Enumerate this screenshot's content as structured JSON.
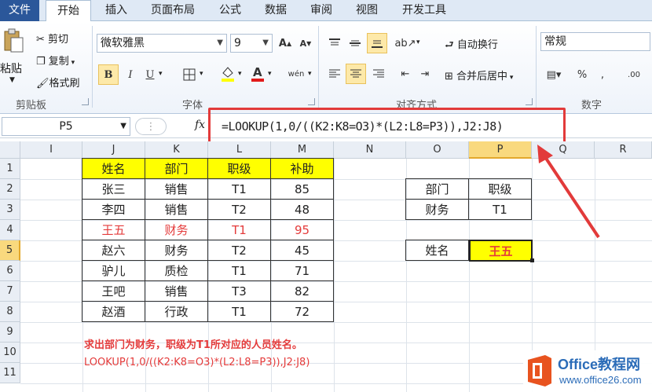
{
  "tabs": [
    "文件",
    "开始",
    "插入",
    "页面布局",
    "公式",
    "数据",
    "审阅",
    "视图",
    "开发工具"
  ],
  "clipboard": {
    "paste": "粘贴",
    "cut": "剪切",
    "copy": "复制",
    "format_painter": "格式刷",
    "group": "剪贴板"
  },
  "font": {
    "name": "微软雅黑",
    "size": "9",
    "group": "字体",
    "bold": "B",
    "italic": "I",
    "underline": "U",
    "phonetic": "wén"
  },
  "alignment": {
    "wrap": "自动换行",
    "merge": "合并后居中",
    "group": "对齐方式"
  },
  "number": {
    "format": "常规",
    "percent": "%",
    "comma": ",",
    "group": "数字"
  },
  "formula_bar": {
    "name_box": "P5",
    "fx": "fx",
    "formula": "=LOOKUP(1,0/((K2:K8=O3)*(L2:L8=P3)),J2:J8)"
  },
  "columns": [
    "I",
    "J",
    "K",
    "L",
    "M",
    "N",
    "O",
    "P",
    "Q",
    "R"
  ],
  "selected_column": "P",
  "rows": [
    "1",
    "2",
    "3",
    "4",
    "5",
    "6",
    "7",
    "8",
    "9",
    "10",
    "11"
  ],
  "selected_row": "5",
  "table": {
    "header": [
      "姓名",
      "部门",
      "职级",
      "补助"
    ],
    "rows": [
      [
        "张三",
        "销售",
        "T1",
        "85"
      ],
      [
        "李四",
        "销售",
        "T2",
        "48"
      ],
      [
        "王五",
        "财务",
        "T1",
        "95"
      ],
      [
        "赵六",
        "财务",
        "T2",
        "45"
      ],
      [
        "驴儿",
        "质检",
        "T1",
        "71"
      ],
      [
        "王吧",
        "销售",
        "T3",
        "82"
      ],
      [
        "赵酒",
        "行政",
        "T1",
        "72"
      ]
    ],
    "highlight_row": 2
  },
  "criteria": {
    "dept_label": "部门",
    "level_label": "职级",
    "dept_value": "财务",
    "level_value": "T1",
    "name_label": "姓名",
    "result": "王五"
  },
  "notes": {
    "line1": "求出部门为财务，职级为T1所对应的人员姓名。",
    "line2": "LOOKUP(1,0/((K2:K8=O3)*(L2:L8=P3)),J2:J8)"
  },
  "logo": {
    "title": "Office教程网",
    "url": "www.office26.com"
  },
  "colors": {
    "accent_red": "#e23a3a",
    "header_yellow": "#ffff00",
    "file_tab": "#2b579a"
  }
}
